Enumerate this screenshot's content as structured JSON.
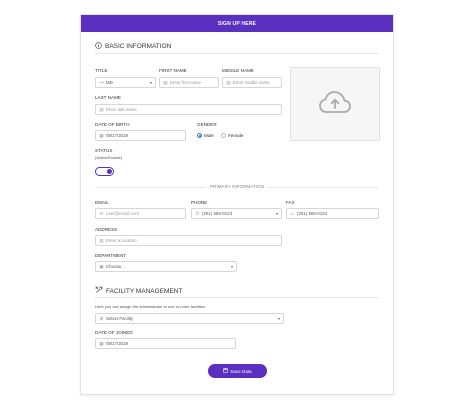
{
  "header": {
    "title": "SIGN UP HERE"
  },
  "basic": {
    "section_title": "BASIC INFORMATION",
    "title_label": "TITLE",
    "title_value": "MD",
    "first_name_label": "FIRST NAME",
    "first_name_placeholder": "Enter first name",
    "middle_name_label": "MIDDLE NAME",
    "middle_name_placeholder": "Enter middle name",
    "last_name_label": "LAST NAME",
    "last_name_placeholder": "Enter last name",
    "dob_label": "DATE OF BIRTH",
    "dob_value": "08/17/2019",
    "gender_label": "GENDER",
    "gender_options": [
      "Male",
      "Female"
    ],
    "gender_selected": "Male",
    "status_label": "STATUS",
    "status_hint": "(Active/Enable)",
    "status_on": true
  },
  "primary": {
    "divider_label": "PRIMARY INFORMATION",
    "email_label": "EMAIL",
    "email_placeholder": "user@email.com",
    "phone_label": "PHONE",
    "phone_placeholder": "(201) 555-0123",
    "fax_label": "FAX",
    "fax_placeholder": "(201) 555-0123",
    "address_label": "ADDRESS",
    "address_placeholder": "Enter a location",
    "department_label": "DEPARTMENT",
    "department_value": "Choose..."
  },
  "facility": {
    "section_title": "FACILITY MANAGEMENT",
    "hint": "Here you can assign the administrator to one or more facilities",
    "select_placeholder": "Select Facility",
    "doj_label": "DATE OF JOINED",
    "doj_value": "08/17/2019"
  },
  "actions": {
    "save_label": "Save Data"
  },
  "colors": {
    "accent": "#5b2fc0",
    "radio": "#3b6fd8"
  }
}
